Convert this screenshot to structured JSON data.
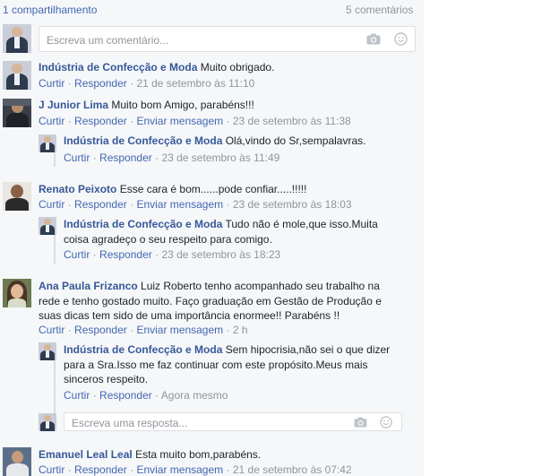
{
  "header": {
    "shares": "1 compartilhamento",
    "comments_count": "5 comentários"
  },
  "composer": {
    "placeholder": "Escreva um comentário..."
  },
  "reply_composer": {
    "placeholder": "Escreva uma resposta..."
  },
  "actions": {
    "like": "Curtir",
    "reply": "Responder",
    "message": "Enviar mensagem",
    "sep": "·"
  },
  "comments": [
    {
      "author": "Indústria de Confecção e Moda",
      "text": "Muito obrigado.",
      "time": "21 de setembro às 11:10"
    },
    {
      "author": "J Junior Lima",
      "text": "Muito bom Amigo, parabéns!!!",
      "time": "23 de setembro às 11:38",
      "reply": {
        "author": "Indústria de Confecção e Moda",
        "text": "Olá,vindo do Sr,sempalavras.",
        "time": "23 de setembro às 11:49"
      }
    },
    {
      "author": "Renato Peixoto",
      "text": "Esse cara é bom......pode confiar.....!!!!!",
      "time": "23 de setembro às 18:03",
      "reply": {
        "author": "Indústria de Confecção e Moda",
        "text_line1": "Tudo não é mole,que isso.Muita",
        "text_line2": "coisa agradeço o seu respeito para comigo.",
        "time": "23 de setembro às 18:23"
      }
    },
    {
      "author": "Ana Paula Frizanco",
      "text_line1": "Luiz Roberto tenho acompanhado seu trabalho na",
      "text_line2": "rede e tenho gostado muito. Faço graduação em Gestão de Produção e",
      "text_line3": "suas dicas tem sido de uma importância enormee!! Parabéns !!",
      "time": "2 h",
      "reply": {
        "author": "Indústria de Confecção e Moda",
        "text_line1": "Sem hipocrisia,não sei o que dizer",
        "text_line2": "para a Sra.Isso me faz continuar com este propósito.Meus mais",
        "text_line3": "sinceros respeito.",
        "time": "Agora mesmo"
      }
    },
    {
      "author": "Emanuel Leal Leal",
      "text": "Esta muito bom,parabéns.",
      "time": "21 de setembro às 07:42"
    }
  ],
  "icons": {
    "camera": "camera-icon",
    "emoji": "emoji-icon"
  }
}
